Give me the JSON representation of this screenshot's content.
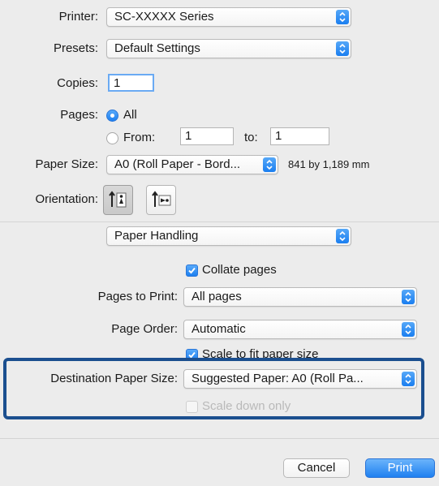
{
  "printer": {
    "label": "Printer:",
    "value": "SC-XXXXX Series"
  },
  "presets": {
    "label": "Presets:",
    "value": "Default Settings"
  },
  "copies": {
    "label": "Copies:",
    "value": "1"
  },
  "pages": {
    "label": "Pages:",
    "all_label": "All",
    "from_label": "From:",
    "from_value": "1",
    "to_label": "to:",
    "to_value": "1",
    "selected": "All"
  },
  "paper_size": {
    "label": "Paper Size:",
    "value": "A0 (Roll Paper - Bord...",
    "dimensions": "841 by 1,189 mm"
  },
  "orientation": {
    "label": "Orientation:",
    "options": [
      "portrait-icon",
      "landscape-icon"
    ],
    "selected": "portrait"
  },
  "section": {
    "value": "Paper Handling"
  },
  "collate": {
    "label": "Collate pages",
    "checked": true
  },
  "pages_to_print": {
    "label": "Pages to Print:",
    "value": "All pages"
  },
  "page_order": {
    "label": "Page Order:",
    "value": "Automatic"
  },
  "scale_to_fit": {
    "label": "Scale to fit paper size",
    "checked": true
  },
  "destination_paper_size": {
    "label": "Destination Paper Size:",
    "value": "Suggested Paper: A0 (Roll Pa..."
  },
  "scale_down_only": {
    "label": "Scale down only",
    "checked": false,
    "enabled": false
  },
  "buttons": {
    "cancel": "Cancel",
    "print": "Print"
  },
  "colors": {
    "accent": "#1f80f0",
    "highlight_border": "#1b4f8f",
    "background": "#ececec"
  }
}
